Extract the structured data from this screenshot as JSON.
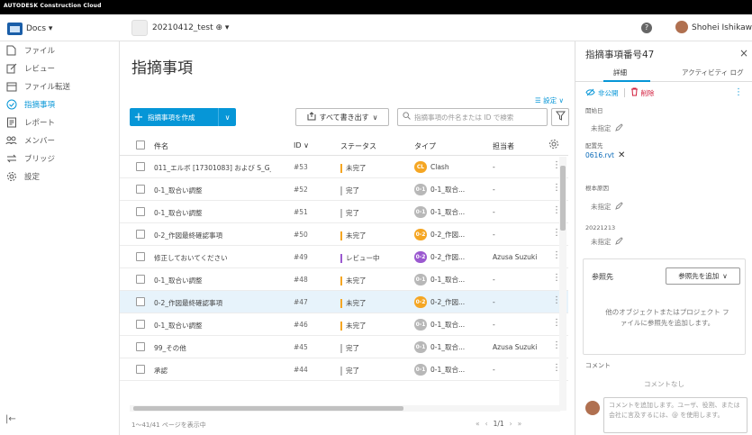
{
  "topbar": {
    "brand": "AUTODESK Construction Cloud"
  },
  "subbar": {
    "app_label": "Docs ▾",
    "project_label": "20210412_test ⊕ ▾",
    "help": "?",
    "user_name": "Shohei Ishikawa"
  },
  "sidebar": {
    "items": [
      {
        "label": "ファイル",
        "icon": "file-icon"
      },
      {
        "label": "レビュー",
        "icon": "review-icon"
      },
      {
        "label": "ファイル転送",
        "icon": "transmittal-icon"
      },
      {
        "label": "指摘事項",
        "icon": "issues-icon",
        "active": true
      },
      {
        "label": "レポート",
        "icon": "report-icon"
      },
      {
        "label": "メンバー",
        "icon": "members-icon"
      },
      {
        "label": "ブリッジ",
        "icon": "bridge-icon"
      },
      {
        "label": "設定",
        "icon": "settings-icon"
      }
    ],
    "collapse": "|←"
  },
  "main": {
    "title": "指摘事項",
    "settings_link": "☰ 設定 ∨",
    "create_label": "指摘事項を作成",
    "export_label": "すべて書き出す",
    "search_placeholder": "指摘事項の件名または ID で検索",
    "columns": {
      "name": "件名",
      "id": "ID ∨",
      "status": "ステータス",
      "type": "タイプ",
      "assignee": "担当者"
    },
    "rows": [
      {
        "name": "011_エルボ [17301083] および S_G_H...",
        "id": "#53",
        "status": "未完了",
        "type_badge": "CL",
        "type_label": "Clash",
        "assignee": "-"
      },
      {
        "name": "0-1_取合い調整",
        "id": "#52",
        "status": "完了",
        "type_badge": "0-1",
        "type_label": "0-1_取合...",
        "assignee": "-"
      },
      {
        "name": "0-1_取合い調整",
        "id": "#51",
        "status": "完了",
        "type_badge": "0-1",
        "type_label": "0-1_取合...",
        "assignee": "-"
      },
      {
        "name": "0-2_作図最終確認事項",
        "id": "#50",
        "status": "未完了",
        "type_badge": "0-2",
        "type_label": "0-2_作図...",
        "assignee": "-"
      },
      {
        "name": "修正しておいてください",
        "id": "#49",
        "status": "レビュー中",
        "type_badge": "0-2",
        "type_label": "0-2_作図...",
        "assignee": "Azusa Suzuki"
      },
      {
        "name": "0-1_取合い調整",
        "id": "#48",
        "status": "未完了",
        "type_badge": "0-1",
        "type_label": "0-1_取合...",
        "assignee": "-"
      },
      {
        "name": "0-2_作図最終確認事項",
        "id": "#47",
        "status": "未完了",
        "type_badge": "0-2",
        "type_label": "0-2_作図...",
        "assignee": "-",
        "selected": true
      },
      {
        "name": "0-1_取合い調整",
        "id": "#46",
        "status": "未完了",
        "type_badge": "0-1",
        "type_label": "0-1_取合...",
        "assignee": "-"
      },
      {
        "name": "99_その他",
        "id": "#45",
        "status": "完了",
        "type_badge": "0-1",
        "type_label": "0-1_取合...",
        "assignee": "Azusa Suzuki"
      },
      {
        "name": "承認",
        "id": "#44",
        "status": "完了",
        "type_badge": "0-1",
        "type_label": "0-1_取合...",
        "assignee": "-"
      }
    ],
    "footer_count": "1～41/41 ページを表示中",
    "pager": {
      "first": "«",
      "prev": "‹",
      "page": "1/1",
      "next": "›",
      "last": "»"
    }
  },
  "panel": {
    "title": "指摘事項番号47",
    "close": "×",
    "tab_detail": "詳細",
    "tab_activity": "アクティビティ ログ",
    "unpublish": "非公開",
    "delete": "削除",
    "more": "⋮",
    "start_date_label": "開始日",
    "start_date_value": "未指定",
    "placement_label": "配置先",
    "placement_value": "0616.rvt",
    "root_cause_label": "根本原因",
    "root_cause_value": "未指定",
    "custom_label": "20221213",
    "custom_value": "未指定",
    "reference_title": "参照先",
    "reference_add": "参照先を追加",
    "reference_empty": "他のオブジェクトまたはプロジェクト ファイルに参照先を追加します。",
    "comment_label": "コメント",
    "comment_none": "コメントなし",
    "comment_placeholder": "コメントを追加します。ユーザ、役割、または会社に言及するには、@ を使用します。"
  },
  "colors": {
    "accent": "#0696d7",
    "status_open": "#f5a623",
    "status_closed": "#bbbbbb",
    "status_review": "#9b59d0",
    "badge_clash": "#f5a623",
    "badge_01": "#b8b8b8",
    "badge_02": "#f5a623",
    "delete": "#d11b3a"
  }
}
